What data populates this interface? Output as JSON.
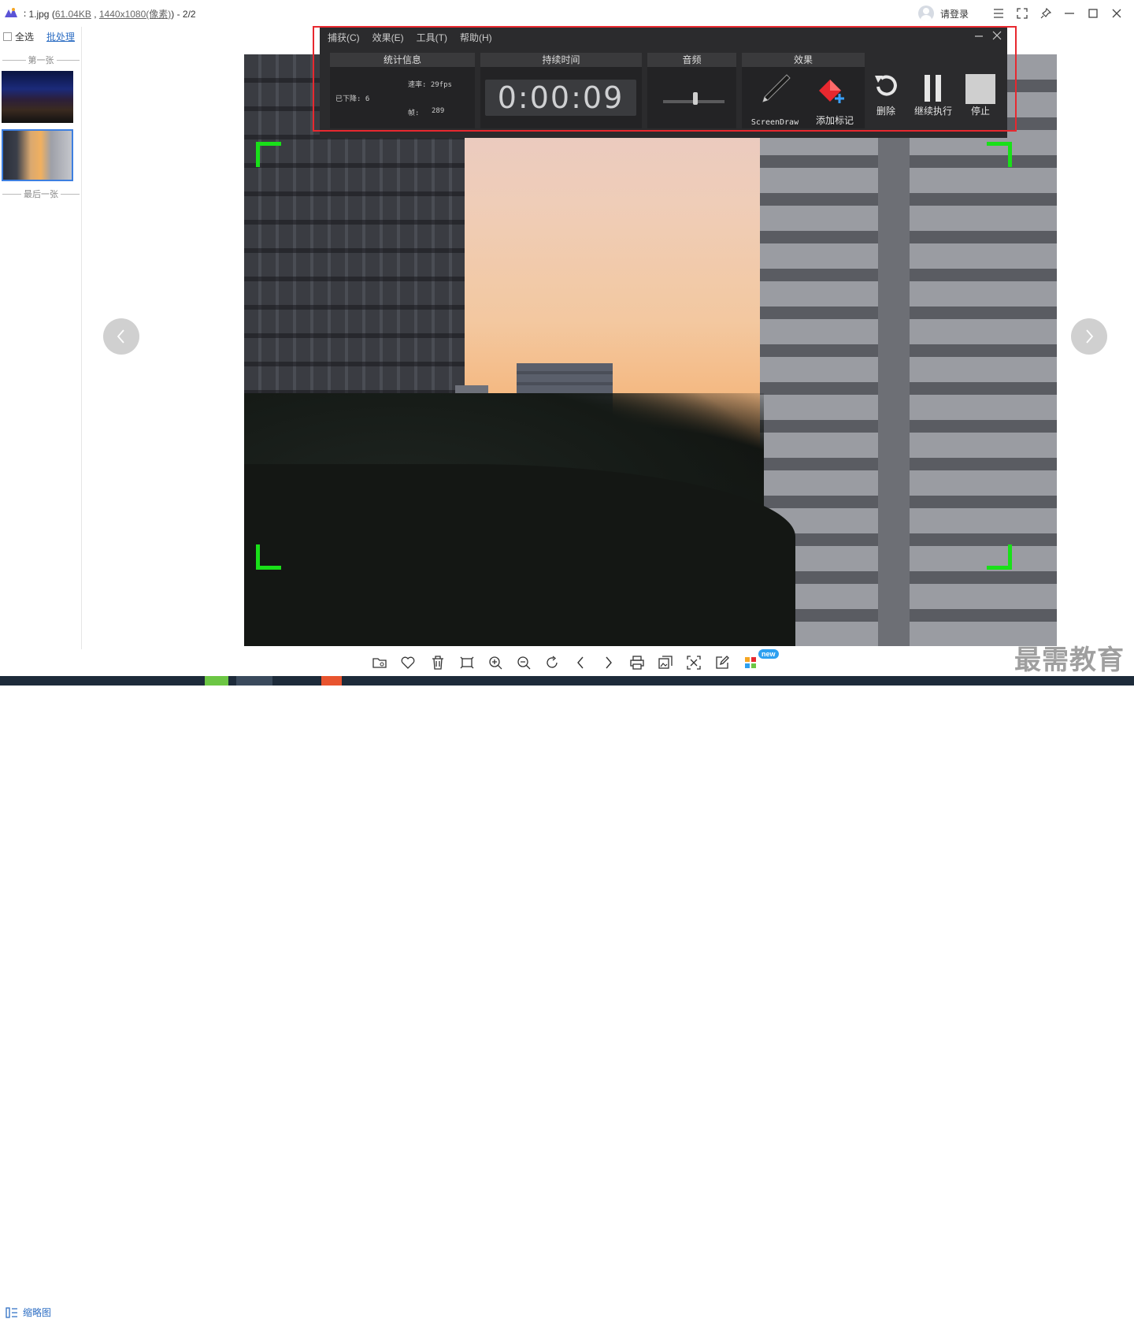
{
  "title": {
    "prefix": "∶ 1.jpg (",
    "size": "61.04KB",
    "sep": " , ",
    "dims": "1440x1080(像素)",
    "suffix": ") - 2/2"
  },
  "header": {
    "login_label": "请登录"
  },
  "sidebar": {
    "select_all": "全选",
    "batch": "批处理",
    "first_label": "第一张",
    "last_label": "最后一张",
    "thumbnail_toggle": "缩略图"
  },
  "recorder": {
    "menu": [
      "捕获(C)",
      "效果(E)",
      "工具(T)",
      "帮助(H)"
    ],
    "stats_title": "统计信息",
    "dropped": "已下降: 6",
    "rate": "速率: 29fps",
    "frames_label": "帧:",
    "frames_value": "289",
    "duration_title": "持续时间",
    "timer": "0:00:09",
    "audio_title": "音频",
    "effects_title": "效果",
    "screendraw": "ScreenDraw",
    "add_marker": "添加标记",
    "delete": "删除",
    "resume": "继续执行",
    "stop": "停止"
  },
  "toolbar": {
    "new_badge": "new"
  },
  "watermark": "最需教育",
  "colors": {
    "recorder_bg": "#2b2b2d",
    "highlight_frame": "#e8282f",
    "capture_corners": "#19e019",
    "link": "#2f6fc4",
    "marker_red": "#e8282f"
  }
}
